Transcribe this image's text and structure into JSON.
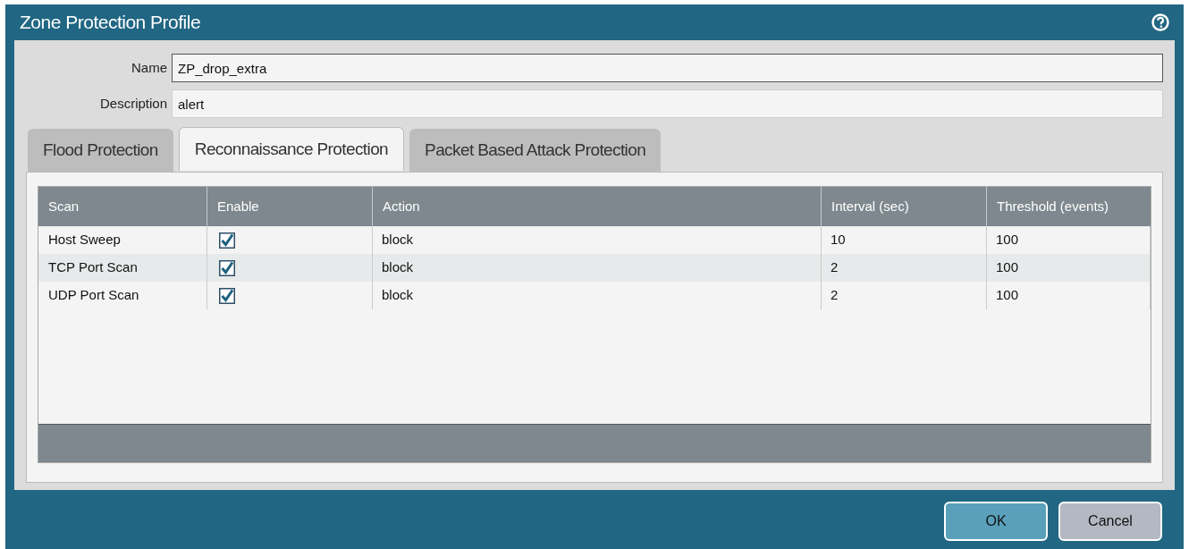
{
  "window": {
    "title": "Zone Protection Profile"
  },
  "fields": [
    {
      "label": "Name",
      "value": "ZP_drop_extra",
      "focused": true
    },
    {
      "label": "Description",
      "value": "alert",
      "focused": false
    }
  ],
  "tabs": [
    {
      "label": "Flood Protection",
      "selected": false
    },
    {
      "label": "Reconnaissance Protection",
      "selected": true
    },
    {
      "label": "Packet Based Attack Protection",
      "selected": false
    }
  ],
  "table": {
    "columns": [
      "Scan",
      "Enable",
      "Action",
      "Interval (sec)",
      "Threshold (events)"
    ],
    "rows": [
      {
        "scan": "Host Sweep",
        "enabled": true,
        "action": "block",
        "interval": "10",
        "threshold": "100"
      },
      {
        "scan": "TCP Port Scan",
        "enabled": true,
        "action": "block",
        "interval": "2",
        "threshold": "100"
      },
      {
        "scan": "UDP Port Scan",
        "enabled": true,
        "action": "block",
        "interval": "2",
        "threshold": "100"
      }
    ]
  },
  "buttons": [
    {
      "label": "OK",
      "kind": "primary"
    },
    {
      "label": "Cancel",
      "kind": "secondary"
    }
  ]
}
